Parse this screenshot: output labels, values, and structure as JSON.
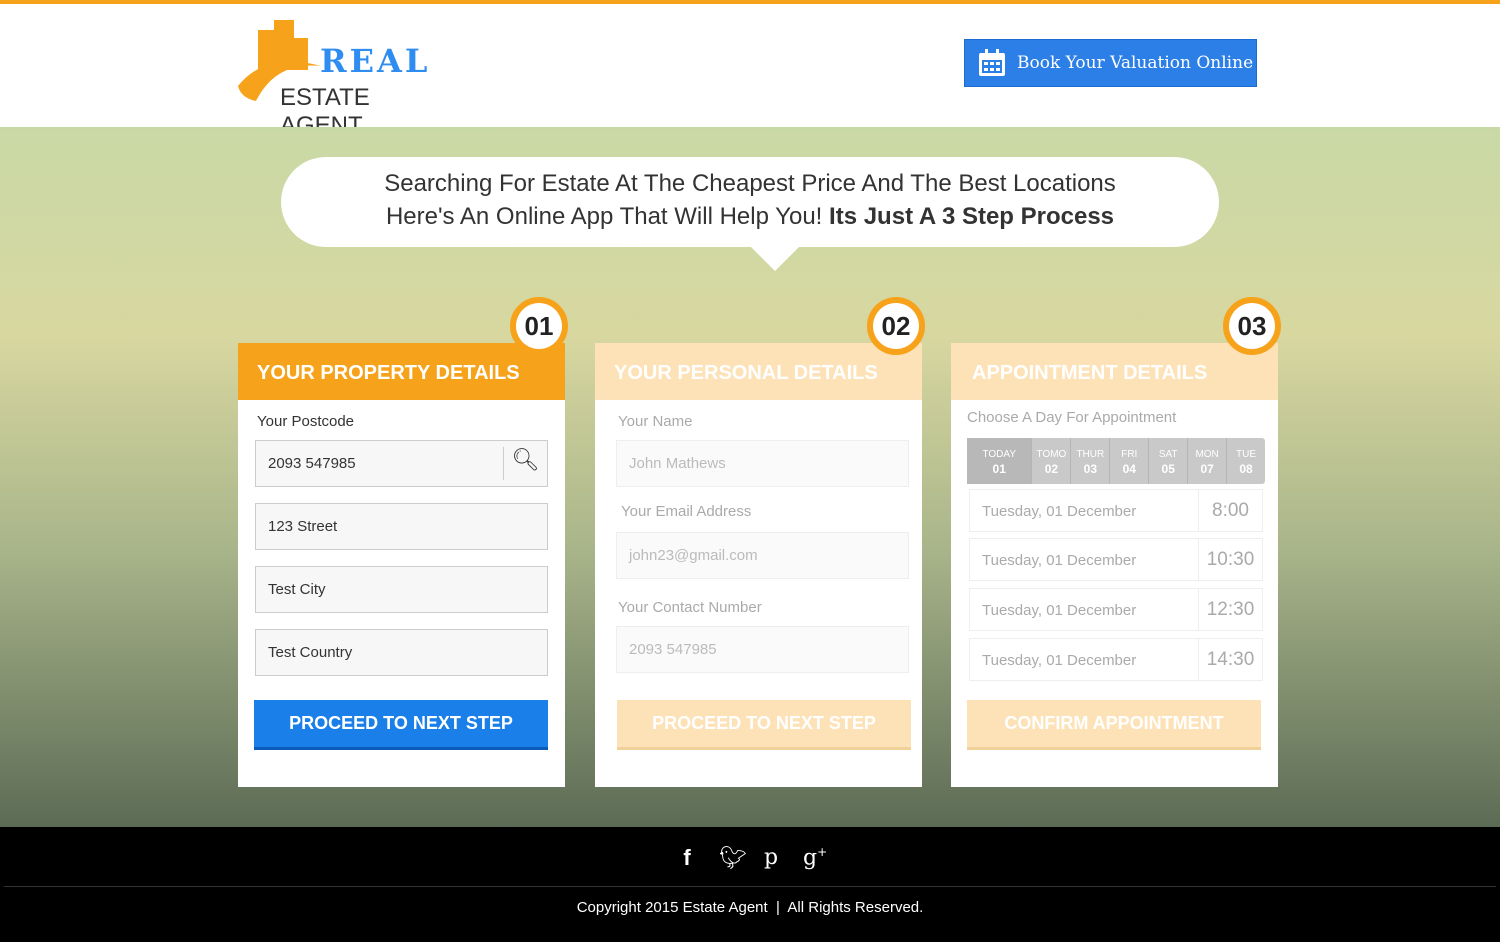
{
  "header": {
    "logo_top": "REAL",
    "logo_bottom": "ESTATE AGENT",
    "book_button": "Book Your Valuation Online"
  },
  "banner": {
    "line1": "Searching For Estate At The Cheapest Price And The Best Locations",
    "line2": "Here's An Online App That Will Help You!",
    "line2_bold": "Its Just A 3 Step Process"
  },
  "step1": {
    "number": "01",
    "title": "YOUR PROPERTY DETAILS",
    "postcode_label": "Your Postcode",
    "postcode": "2093 547985",
    "street": "123 Street",
    "city": "Test City",
    "country": "Test Country",
    "button": "PROCEED TO NEXT STEP"
  },
  "step2": {
    "number": "02",
    "title": "YOUR PERSONAL DETAILS",
    "name_label": "Your Name",
    "name": "John Mathews",
    "email_label": "Your Email Address",
    "email": "john23@gmail.com",
    "phone_label": "Your Contact Number",
    "phone": "2093 547985",
    "button": "PROCEED TO NEXT STEP"
  },
  "step3": {
    "number": "03",
    "title": "APPOINTMENT DETAILS",
    "day_label": "Choose A Day For Appointment",
    "days": [
      {
        "d": "TODAY",
        "n": "01"
      },
      {
        "d": "TOMO",
        "n": "02"
      },
      {
        "d": "THUR",
        "n": "03"
      },
      {
        "d": "FRI",
        "n": "04"
      },
      {
        "d": "SAT",
        "n": "05"
      },
      {
        "d": "MON",
        "n": "07"
      },
      {
        "d": "TUE",
        "n": "08"
      }
    ],
    "slots": [
      {
        "date": "Tuesday, 01 December",
        "time": "8:00"
      },
      {
        "date": "Tuesday, 01 December",
        "time": "10:30"
      },
      {
        "date": "Tuesday, 01 December",
        "time": "12:30"
      },
      {
        "date": "Tuesday, 01 December",
        "time": "14:30"
      }
    ],
    "button": "CONFIRM APPOINTMENT"
  },
  "footer": {
    "copyright": "Copyright 2015 Estate Agent  |  All Rights Reserved."
  }
}
